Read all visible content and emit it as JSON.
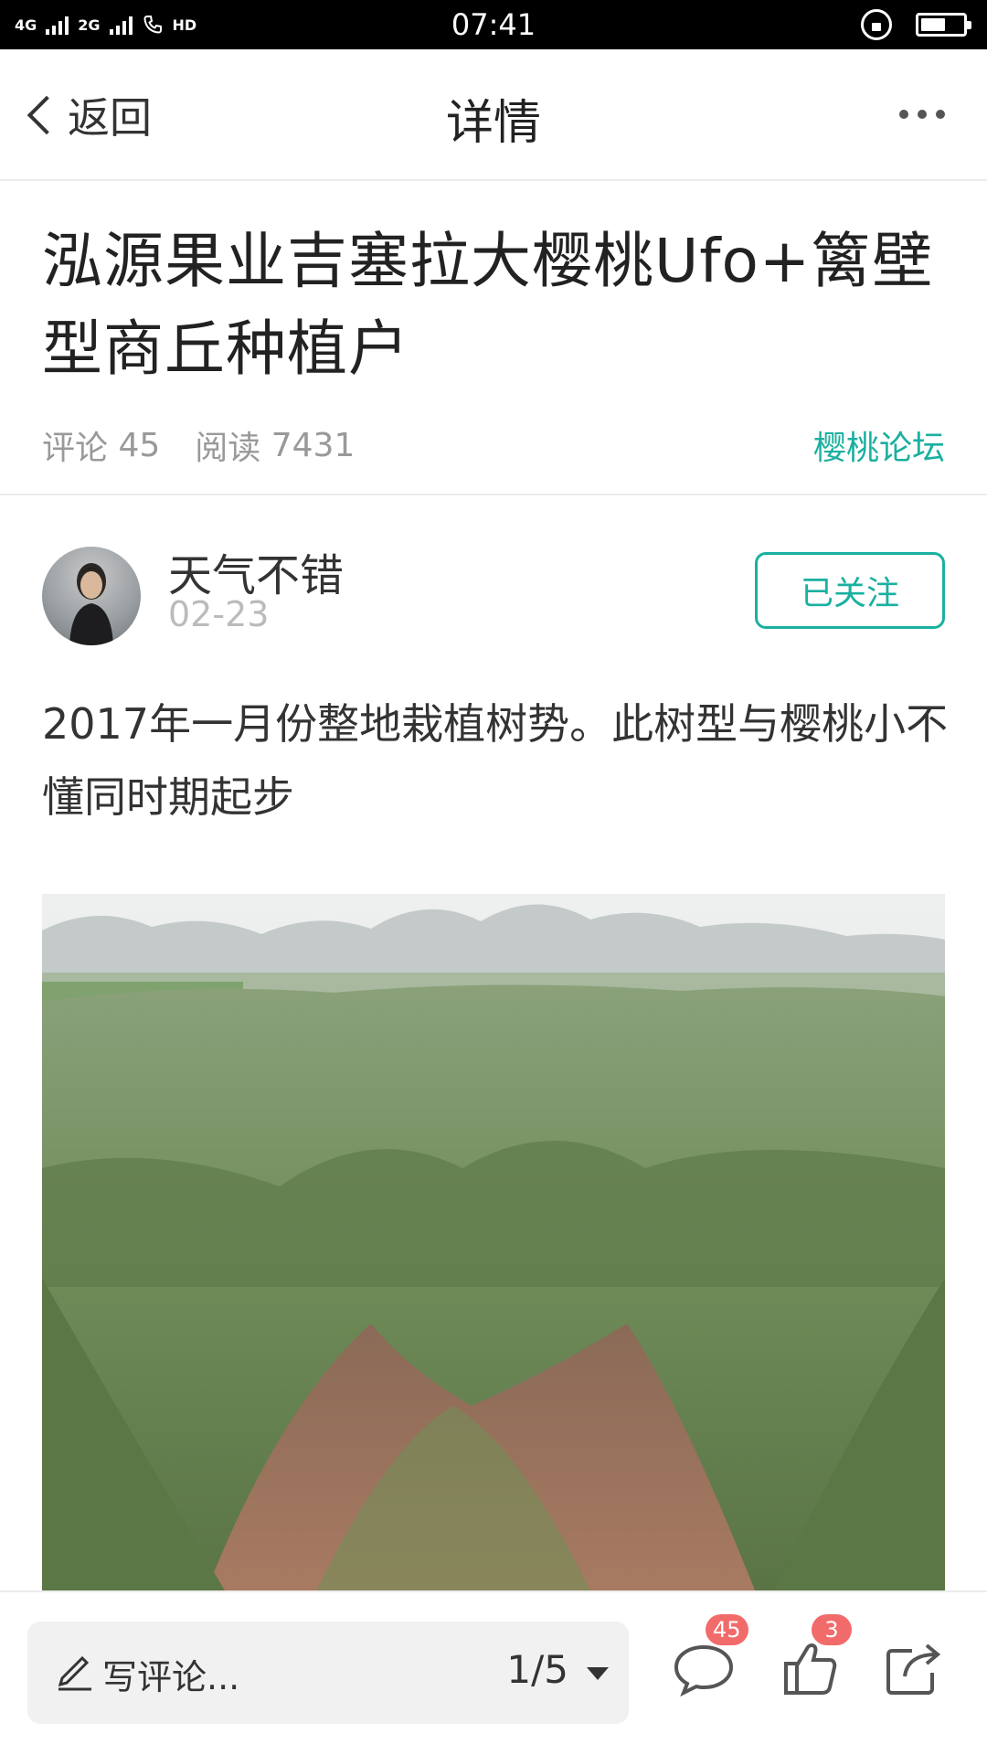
{
  "status_bar": {
    "network_left": "4G",
    "network_left2": "4G",
    "network_right": "2G",
    "hd": "HD",
    "time": "07:41"
  },
  "nav": {
    "back_label": "返回",
    "title": "详情"
  },
  "post": {
    "title": "泓源果业吉塞拉大樱桃Ufo+篱壁型商丘种植户",
    "comments_label": "评论",
    "comments_count": "45",
    "reads_label": "阅读",
    "reads_count": "7431",
    "forum": "樱桃论坛",
    "author": "天气不错",
    "date": "02-23",
    "follow_label": "已关注",
    "body": "2017年一月份整地栽植树势。此树型与樱桃小不懂同时期起步"
  },
  "bottom_bar": {
    "comment_placeholder": "写评论...",
    "pager": "1/5",
    "comment_badge": "45",
    "like_badge": "3"
  },
  "colors": {
    "accent": "#1ab0a0",
    "badge": "#f26b6b"
  },
  "icons": [
    "chevron-left-icon",
    "more-icon",
    "pencil-icon",
    "dropdown-triangle-icon",
    "comment-icon",
    "thumb-up-icon",
    "share-icon",
    "lock-rotation-icon",
    "battery-icon",
    "signal-icon",
    "phone-hd-icon"
  ]
}
